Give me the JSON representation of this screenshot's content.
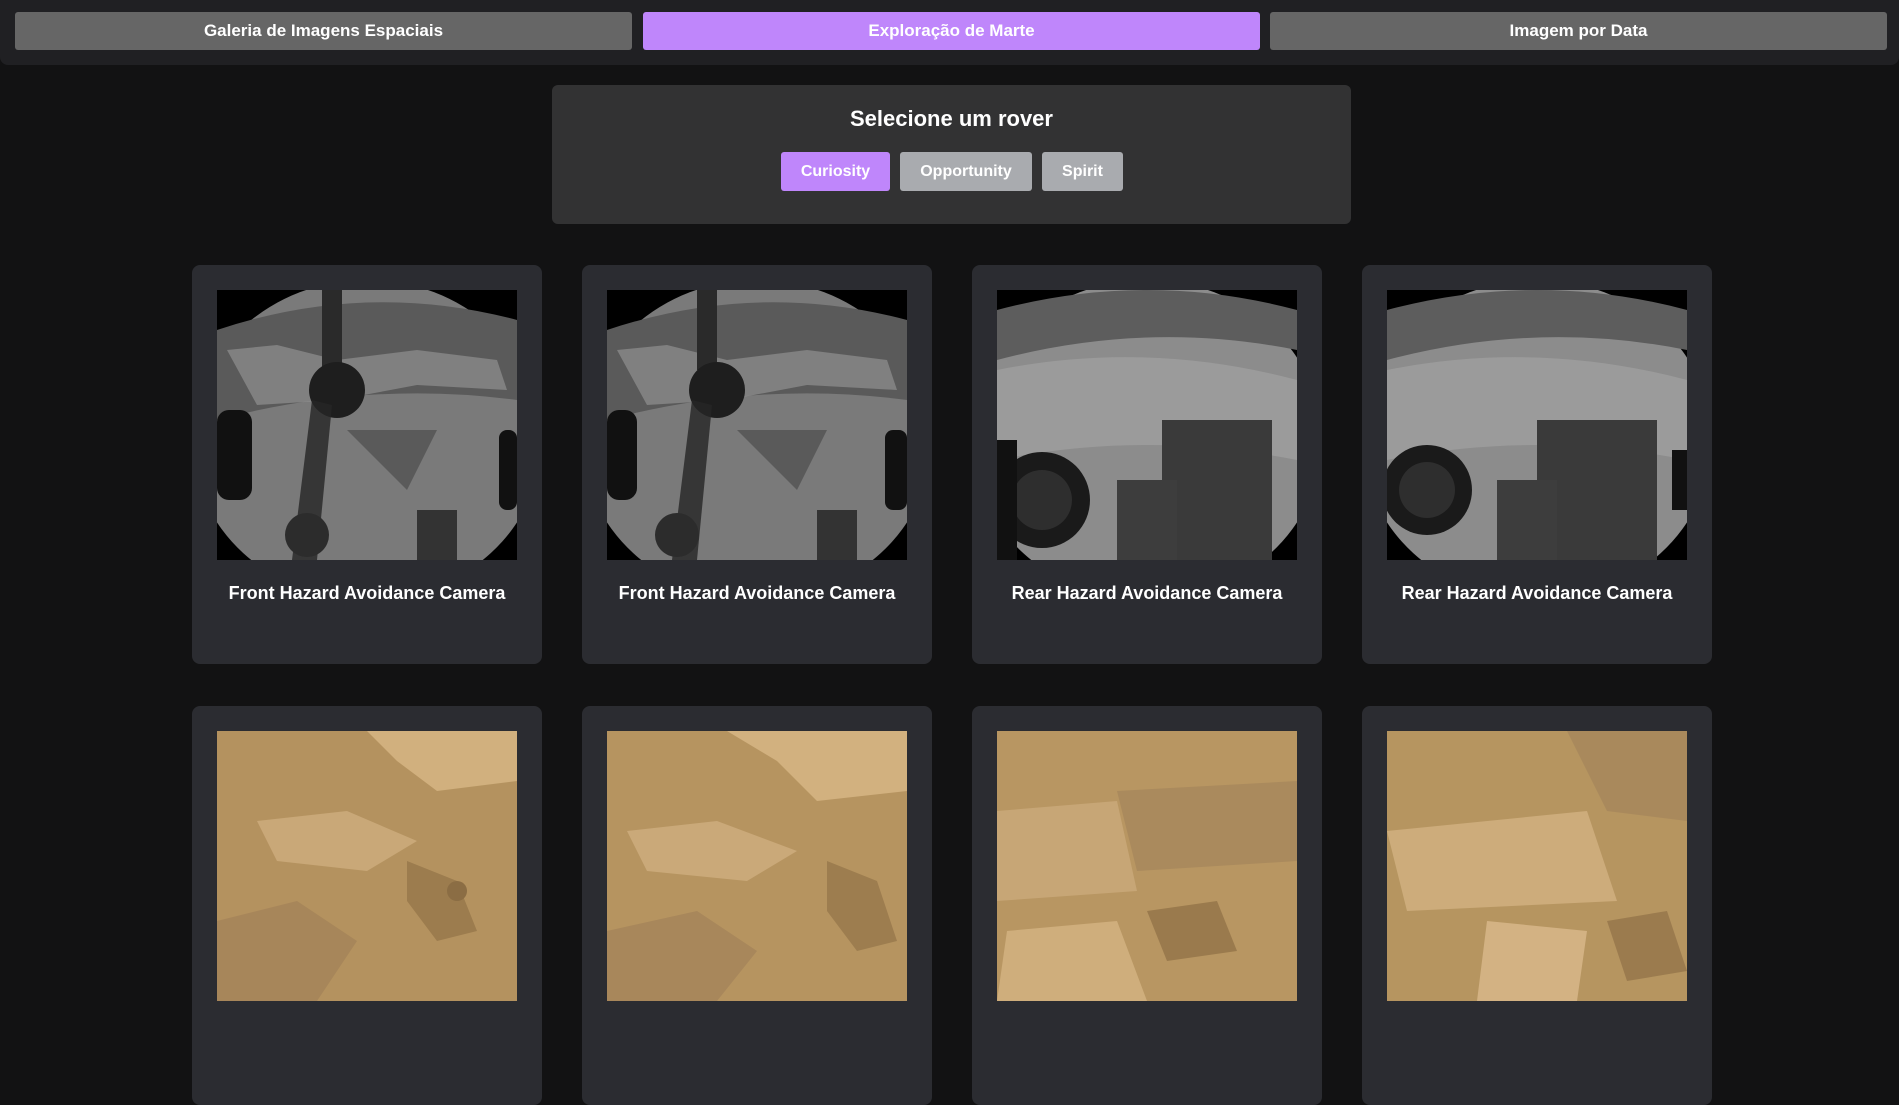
{
  "nav": {
    "tabs": [
      {
        "label": "Galeria de Imagens Espaciais"
      },
      {
        "label": "Exploração de Marte"
      },
      {
        "label": "Imagem por Data"
      }
    ],
    "active_index": 1
  },
  "rover_selector": {
    "title": "Selecione um rover",
    "rovers": [
      {
        "label": "Curiosity"
      },
      {
        "label": "Opportunity"
      },
      {
        "label": "Spirit"
      }
    ],
    "active_index": 0
  },
  "photos": [
    {
      "camera": "Front Hazard Avoidance Camera",
      "kind": "hazcam-front"
    },
    {
      "camera": "Front Hazard Avoidance Camera",
      "kind": "hazcam-front"
    },
    {
      "camera": "Rear Hazard Avoidance Camera",
      "kind": "hazcam-rear"
    },
    {
      "camera": "Rear Hazard Avoidance Camera",
      "kind": "hazcam-rear"
    },
    {
      "camera": "",
      "kind": "color-terrain"
    },
    {
      "camera": "",
      "kind": "color-terrain"
    },
    {
      "camera": "",
      "kind": "color-terrain"
    },
    {
      "camera": "",
      "kind": "color-terrain"
    }
  ],
  "colors": {
    "accent": "#bf86fb",
    "inactive_tab": "#666666",
    "inactive_rover": "#a9abaf",
    "card_bg": "#2b2c31",
    "panel_bg": "#323233",
    "page_bg": "#121213"
  }
}
